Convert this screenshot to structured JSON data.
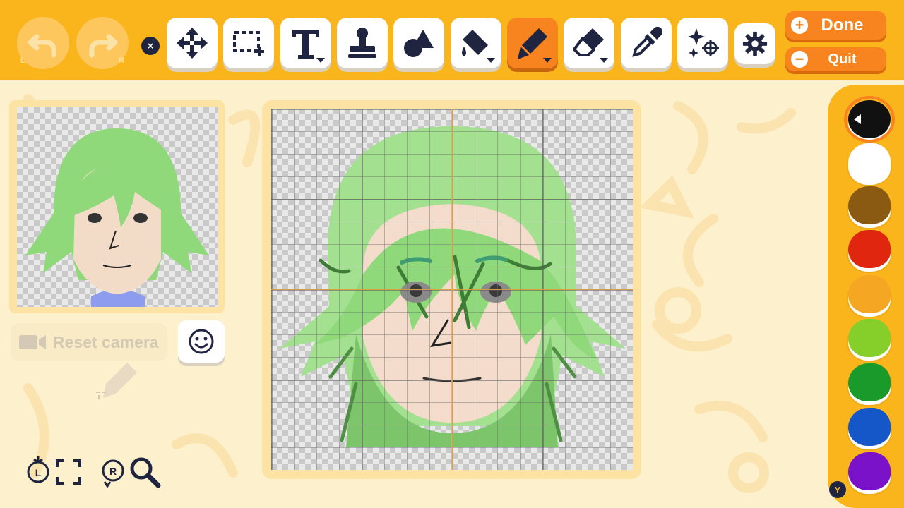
{
  "toolbar": {
    "undo_tag": "L",
    "redo_tag": "R",
    "close_symbol": "×",
    "tools": [
      {
        "name": "move",
        "icon": "move-arrows-icon"
      },
      {
        "name": "select",
        "icon": "selection-rect-icon"
      },
      {
        "name": "text",
        "icon": "text-icon",
        "glyph": "T"
      },
      {
        "name": "stamp",
        "icon": "stamp-icon"
      },
      {
        "name": "shapes",
        "icon": "shapes-icon"
      },
      {
        "name": "fill",
        "icon": "paint-bucket-icon"
      },
      {
        "name": "pen",
        "icon": "marker-pen-icon",
        "active": true
      },
      {
        "name": "eraser",
        "icon": "eraser-icon"
      },
      {
        "name": "eyedropper",
        "icon": "eyedropper-icon"
      },
      {
        "name": "sparkle",
        "icon": "sparkle-target-icon"
      }
    ],
    "done_label": "Done",
    "done_symbol": "+",
    "quit_label": "Quit",
    "quit_symbol": "−"
  },
  "preview": {
    "reset_camera_label": "Reset camera"
  },
  "controls": {
    "zoom_tag": "L",
    "zoom_r_tag": "R"
  },
  "palette": {
    "colors": [
      "#111111",
      "#ffffff",
      "#8a5a12",
      "#e0260f",
      "#f5a623",
      "#86cf2a",
      "#1a9a2a",
      "#1556c9",
      "#7a12c9"
    ],
    "selected_index": 0,
    "y_button": "Y"
  },
  "colors": {
    "toolbar_bg": "#fbb51c",
    "accent": "#f7841e",
    "background": "#fdf0cc",
    "hair": "#8fd97a"
  }
}
